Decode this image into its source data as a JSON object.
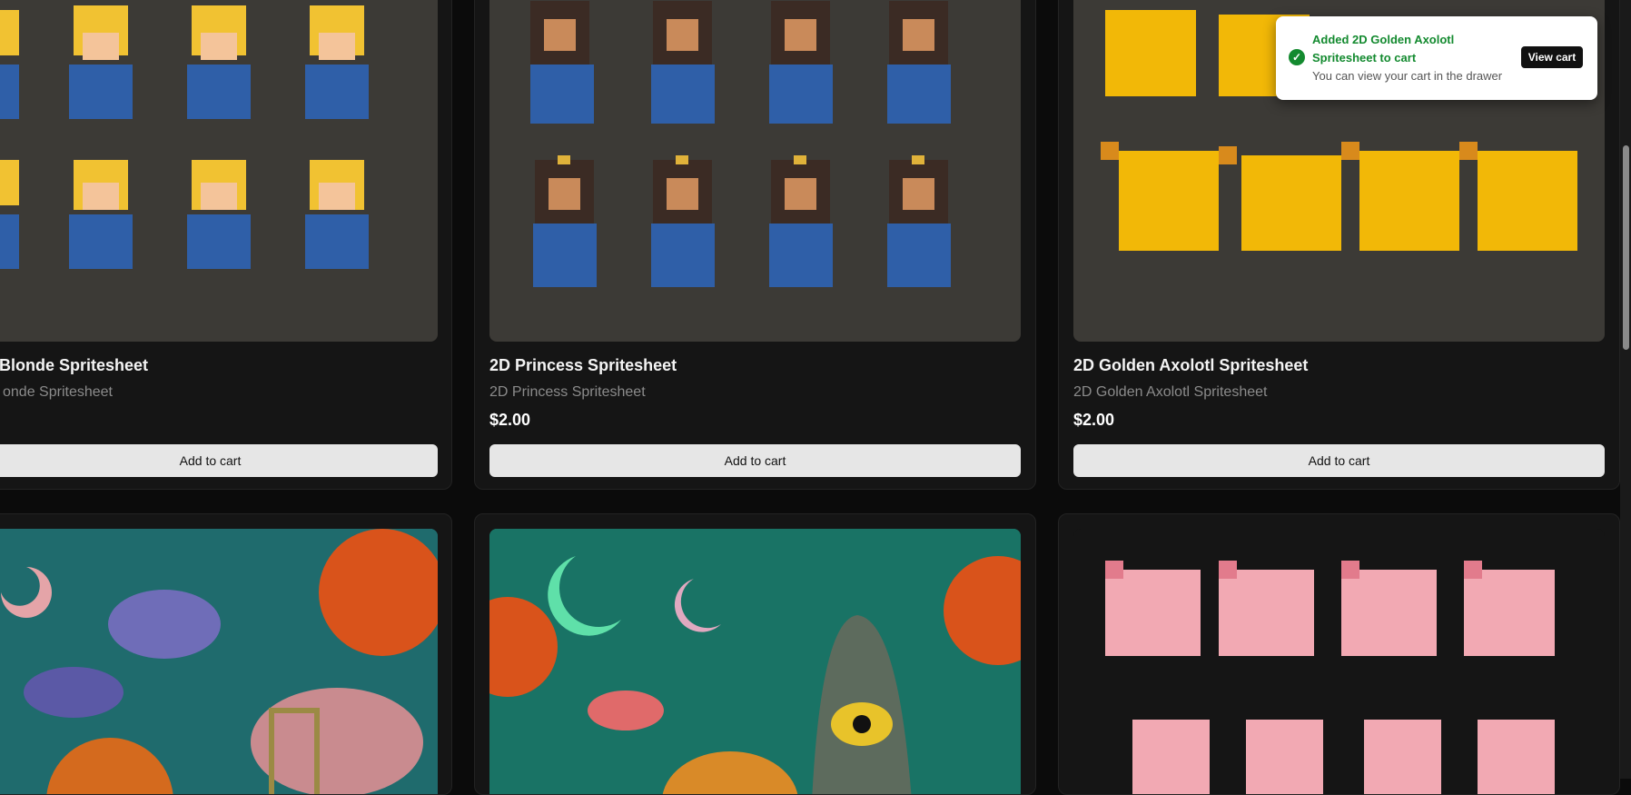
{
  "products": [
    {
      "title": "Blonde Spritesheet",
      "subtitle": "onde Spritesheet",
      "price": "",
      "button": "Add to cart"
    },
    {
      "title": "2D Princess Spritesheet",
      "subtitle": "2D Princess Spritesheet",
      "price": "$2.00",
      "button": "Add to cart"
    },
    {
      "title": "2D Golden Axolotl Spritesheet",
      "subtitle": "2D Golden Axolotl Spritesheet",
      "price": "$2.00",
      "button": "Add to cart"
    }
  ],
  "toast": {
    "title": "Added 2D Golden Axolotl Spritesheet to cart",
    "description": "You can view your cart in the drawer",
    "button": "View cart"
  },
  "colors": {
    "background": "#0b0b0b",
    "card": "#151515",
    "button": "#e6e6e6",
    "success": "#138a2f"
  }
}
